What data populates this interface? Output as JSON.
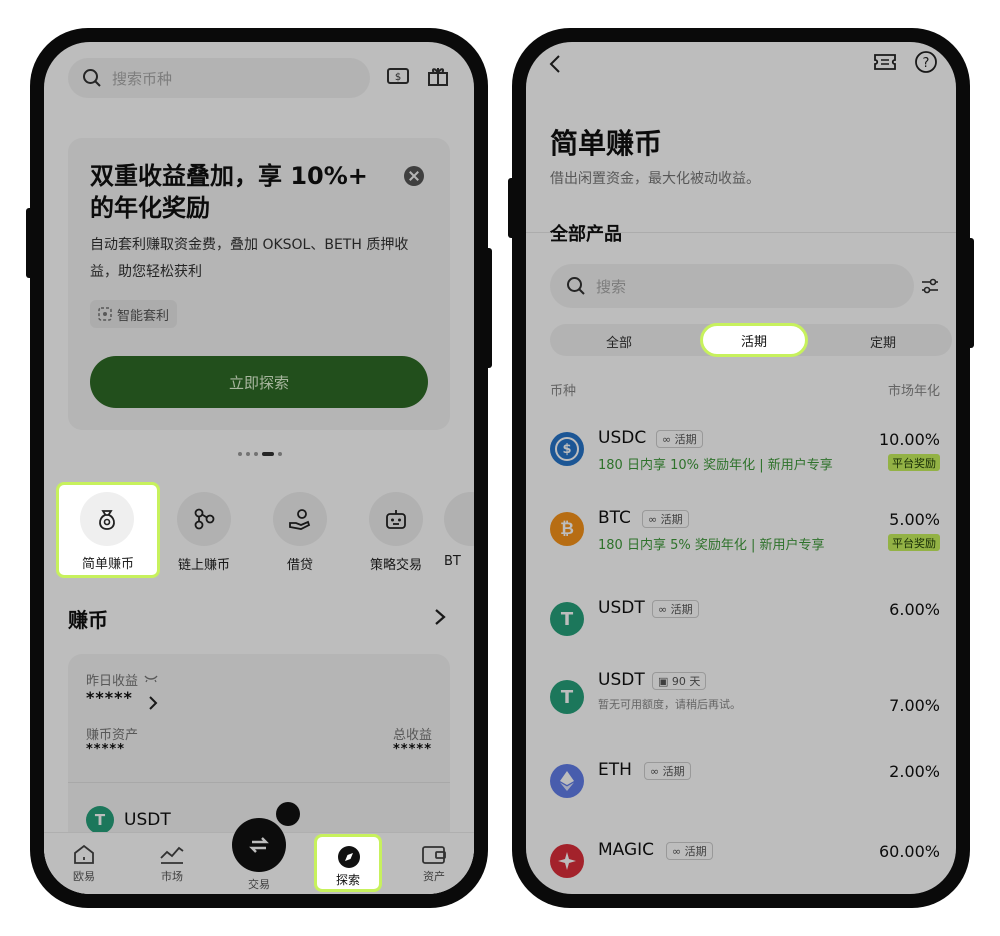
{
  "left": {
    "search_placeholder": "搜索币种",
    "banner": {
      "title": "双重收益叠加，享 10%+ 的年化奖励",
      "description": "自动套利赚取资金费，叠加 OKSOL、BETH 质押收益，助您轻松获利",
      "tag": "智能套利",
      "cta": "立即探索"
    },
    "features": [
      {
        "label": "简单赚币",
        "icon": "money-bag-icon"
      },
      {
        "label": "链上赚币",
        "icon": "chain-nodes-icon"
      },
      {
        "label": "借贷",
        "icon": "hand-coin-icon"
      },
      {
        "label": "策略交易",
        "icon": "robot-icon"
      },
      {
        "label": "BT"
      }
    ],
    "earn": {
      "title": "赚币",
      "yesterday_label": "昨日收益",
      "yesterday_value": "*****",
      "asset_label": "赚币资产",
      "asset_value": "*****",
      "total_label": "总收益",
      "total_value": "*****",
      "coin": "USDT"
    },
    "tabs": [
      "欧易",
      "市场",
      "交易",
      "探索",
      "资产"
    ]
  },
  "right": {
    "title": "简单赚币",
    "subtitle": "借出闲置资金，最大化被动收益。",
    "section": "全部产品",
    "search_placeholder": "搜索",
    "segments": [
      "全部",
      "活期",
      "定期"
    ],
    "col_coin": "币种",
    "col_rate": "市场年化",
    "products": [
      {
        "name": "USDC",
        "badge": "活期",
        "rate": "10.00%",
        "promo": "180 日内享 10% 奖励年化 | 新用户专享",
        "plat": "平台奖励",
        "color": "#2775ca",
        "icon": "usdc-coin-icon"
      },
      {
        "name": "BTC",
        "badge": "活期",
        "rate": "5.00%",
        "promo": "180 日内享 5% 奖励年化 | 新用户专享",
        "plat": "平台奖励",
        "color": "#f7931a",
        "icon": "btc-coin-icon"
      },
      {
        "name": "USDT",
        "badge": "活期",
        "rate": "6.00%",
        "color": "#26a17b",
        "icon": "usdt-coin-icon"
      },
      {
        "name": "USDT",
        "badge": "90 天",
        "rate": "7.00%",
        "note": "暂无可用额度，请稍后再试。",
        "color": "#26a17b",
        "icon": "usdt-coin-icon"
      },
      {
        "name": "ETH",
        "badge": "活期",
        "rate": "2.00%",
        "color": "#627eea",
        "icon": "eth-coin-icon"
      },
      {
        "name": "MAGIC",
        "badge": "活期",
        "rate": "60.00%",
        "color": "#dc2f3a",
        "icon": "magic-coin-icon"
      }
    ]
  },
  "colors": {
    "accent_highlight": "#c7f15d",
    "cta_green": "#2f6b26",
    "promo_green": "#3f9a3a"
  }
}
